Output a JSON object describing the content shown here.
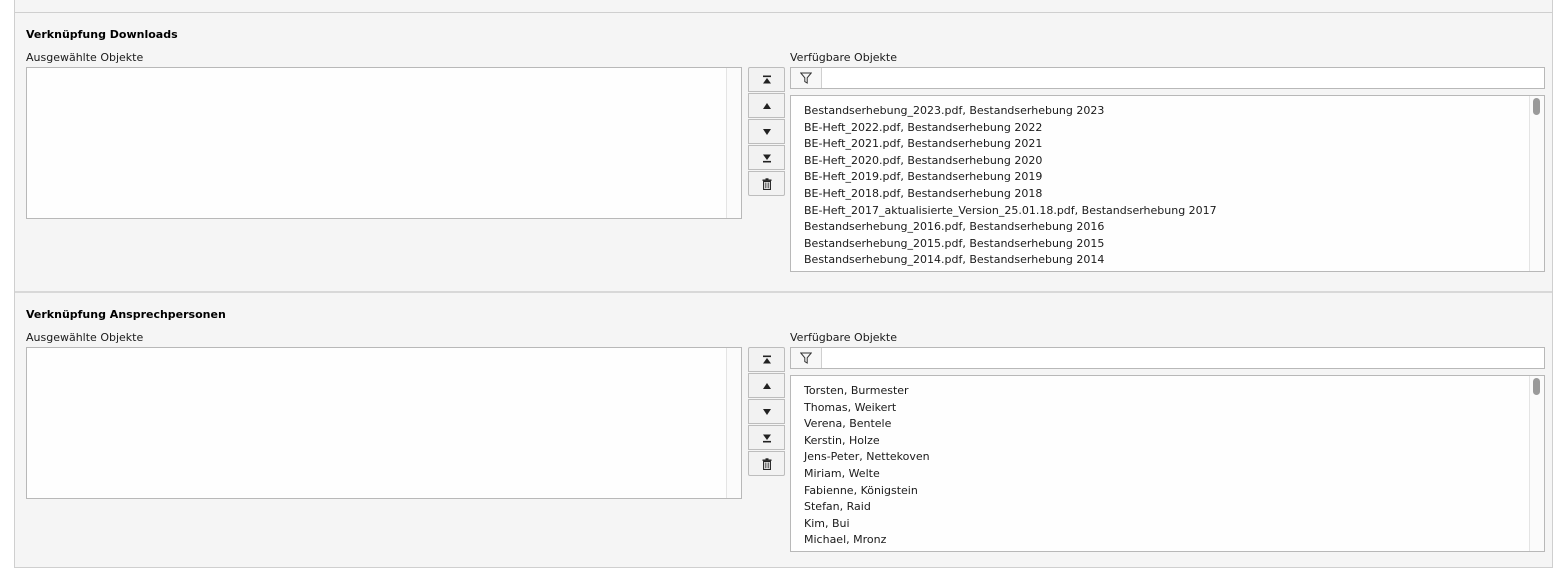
{
  "sections": [
    {
      "title": "Verknüpfung Downloads",
      "selected_label": "Ausgewählte Objekte",
      "available_label": "Verfügbare Objekte",
      "filter_value": "",
      "items": [
        "Bestandserhebung_2023.pdf, Bestandserhebung 2023",
        "BE-Heft_2022.pdf, Bestandserhebung 2022",
        "BE-Heft_2021.pdf, Bestandserhebung 2021",
        "BE-Heft_2020.pdf, Bestandserhebung 2020",
        "BE-Heft_2019.pdf, Bestandserhebung 2019",
        "BE-Heft_2018.pdf, Bestandserhebung 2018",
        "BE-Heft_2017_aktualisierte_Version_25.01.18.pdf, Bestandserhebung 2017",
        "Bestandserhebung_2016.pdf, Bestandserhebung 2016",
        "Bestandserhebung_2015.pdf, Bestandserhebung 2015",
        "Bestandserhebung_2014.pdf, Bestandserhebung 2014"
      ]
    },
    {
      "title": "Verknüpfung Ansprechpersonen",
      "selected_label": "Ausgewählte Objekte",
      "available_label": "Verfügbare Objekte",
      "filter_value": "",
      "items": [
        "Torsten, Burmester",
        "Thomas, Weikert",
        "Verena, Bentele",
        "Kerstin, Holze",
        "Jens-Peter, Nettekoven",
        "Miriam, Welte",
        "Fabienne, Königstein",
        "Stefan, Raid",
        "Kim, Bui",
        "Michael, Mronz"
      ]
    }
  ],
  "icons": {
    "move_top": "move-top-icon",
    "move_up": "move-up-icon",
    "move_down": "move-down-icon",
    "move_bottom": "move-bottom-icon",
    "remove": "trash-icon",
    "filter": "filter-icon"
  }
}
